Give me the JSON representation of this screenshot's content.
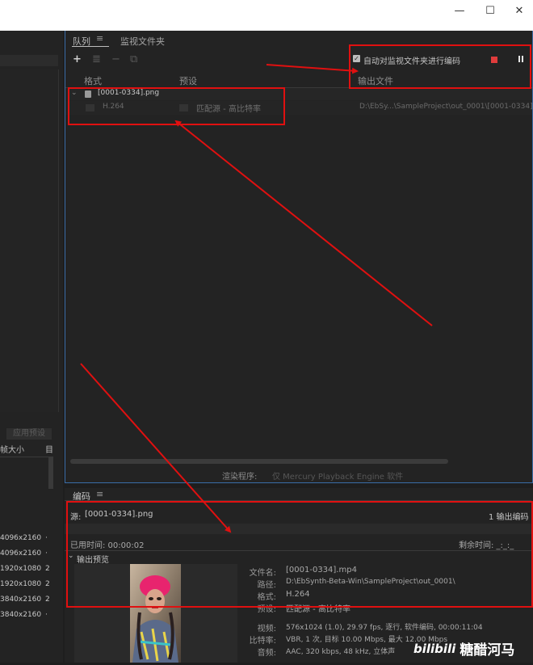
{
  "window": {
    "minimize": "—",
    "maximize": "☐",
    "close": "✕"
  },
  "left": {
    "apply_preset": "应用预设",
    "col_frame_size": "帧大小",
    "col_target": "目",
    "rows": [
      "4096x2160",
      "4096x2160",
      "1920x1080",
      "1920x1080",
      "3840x2160",
      "3840x2160"
    ]
  },
  "queue": {
    "tab_queue": "队列",
    "tab_watch": "监视文件夹",
    "auto_encode_label": "自动对监视文件夹进行编码",
    "col_format": "格式",
    "col_preset": "预设",
    "col_output": "输出文件",
    "item_name": "[0001-0334].png",
    "format": "H.264",
    "preset": "匹配源 - 高比特率",
    "output": "D:\\EbSy...\\SampleProject\\out_0001\\[0001-0334].mp",
    "renderer_label": "渲染程序:",
    "renderer_value": "仅 Mercury Playback Engine 软件"
  },
  "encode": {
    "title": "编码",
    "source_label": "源:",
    "source_value": "[0001-0334].png",
    "output_count": "1 输出编码",
    "elapsed": "已用时间: 00:00:02",
    "remaining": "剩余时间: _:_:_",
    "preview_label": "输出预览",
    "details": [
      {
        "label": "文件名:",
        "value": "[0001-0334].mp4"
      },
      {
        "label": "路径:",
        "value": "D:\\EbSynth-Beta-Win\\SampleProject\\out_0001\\"
      },
      {
        "label": "格式:",
        "value": "H.264"
      },
      {
        "label": "预设:",
        "value": "匹配源 - 高比特率"
      },
      {
        "label": "视频:",
        "value": "576x1024 (1.0), 29.97 fps, 逐行, 软件编码, 00:00:11:04"
      },
      {
        "label": "比特率:",
        "value": "VBR, 1 次, 目标 10.00 Mbps, 最大 12.00 Mbps"
      },
      {
        "label": "音频:",
        "value": "AAC, 320 kbps, 48 kHz, 立体声"
      }
    ]
  },
  "watermark": "糖醋河马",
  "watermark_brand": "bilibili",
  "colors": {
    "annotation": "#e01010",
    "stop": "#e03c3c",
    "accent": "#3a6da8"
  }
}
